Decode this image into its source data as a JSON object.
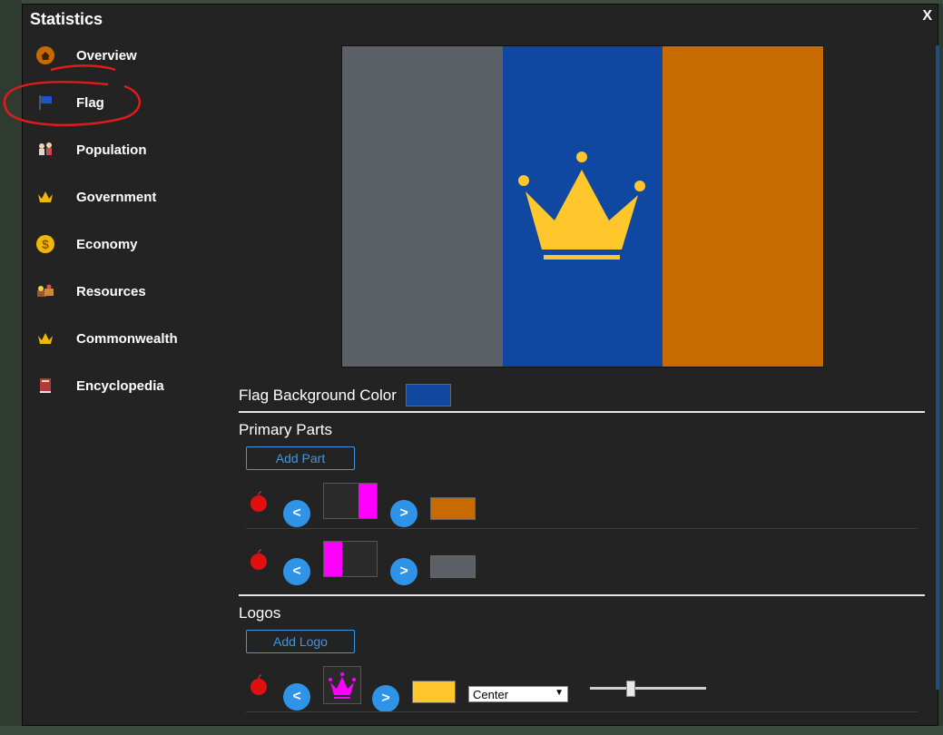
{
  "window": {
    "title": "Statistics",
    "close_label": "X"
  },
  "nav": {
    "items": [
      {
        "label": "Overview",
        "icon": "home-icon"
      },
      {
        "label": "Flag",
        "icon": "flag-icon"
      },
      {
        "label": "Population",
        "icon": "people-icon"
      },
      {
        "label": "Government",
        "icon": "crown-icon"
      },
      {
        "label": "Economy",
        "icon": "coin-icon"
      },
      {
        "label": "Resources",
        "icon": "resources-icon"
      },
      {
        "label": "Commonwealth",
        "icon": "crown-icon"
      },
      {
        "label": "Encyclopedia",
        "icon": "book-icon"
      }
    ],
    "selected": "Flag"
  },
  "flag": {
    "stripes": [
      "#5b5f66",
      "#0f47a1",
      "#c76a00"
    ],
    "emblem_color": "#ffc72c",
    "emblem": "crown-icon"
  },
  "flag_background": {
    "label": "Flag Background Color",
    "color": "#0f47a1"
  },
  "primary_parts": {
    "title": "Primary Parts",
    "add_label": "Add Part",
    "prev_label": "<",
    "next_label": ">",
    "rows": [
      {
        "color": "#c76a00",
        "preview_fill": "#ff00ff",
        "preview_side": "right"
      },
      {
        "color": "#5b5f66",
        "preview_fill": "#ff00ff",
        "preview_side": "left"
      }
    ]
  },
  "logos": {
    "title": "Logos",
    "add_label": "Add Logo",
    "prev_label": "<",
    "next_label": ">",
    "rows": [
      {
        "color": "#ffc72c",
        "position": "Center",
        "size_fraction": 0.35
      }
    ]
  }
}
